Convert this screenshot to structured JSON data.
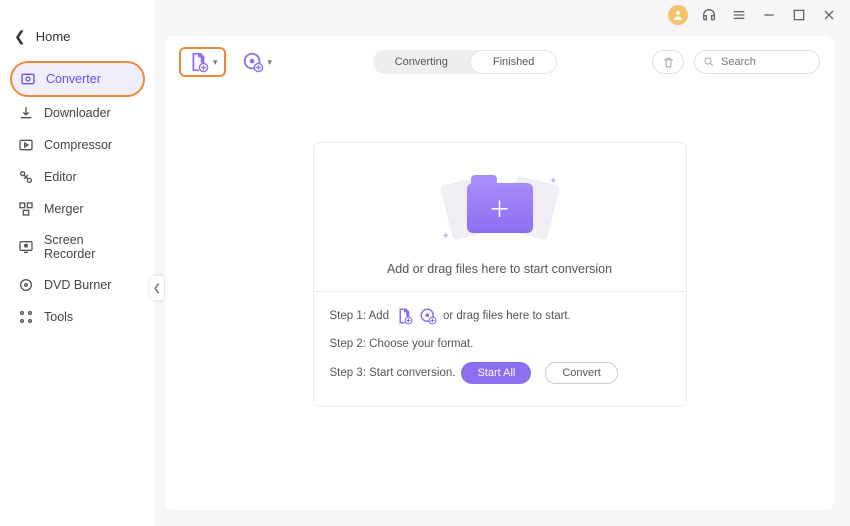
{
  "sidebar": {
    "home": "Home",
    "items": [
      {
        "label": "Converter"
      },
      {
        "label": "Downloader"
      },
      {
        "label": "Compressor"
      },
      {
        "label": "Editor"
      },
      {
        "label": "Merger"
      },
      {
        "label": "Screen Recorder"
      },
      {
        "label": "DVD Burner"
      },
      {
        "label": "Tools"
      }
    ]
  },
  "toolbar": {
    "segments": {
      "converting": "Converting",
      "finished": "Finished"
    },
    "search_placeholder": "Search"
  },
  "drop": {
    "main_text": "Add or drag files here to start conversion",
    "step1_a": "Step 1: Add",
    "step1_b": "or drag files here to start.",
    "step2": "Step 2: Choose your format.",
    "step3": "Step 3: Start conversion.",
    "start_all": "Start All",
    "convert": "Convert"
  }
}
